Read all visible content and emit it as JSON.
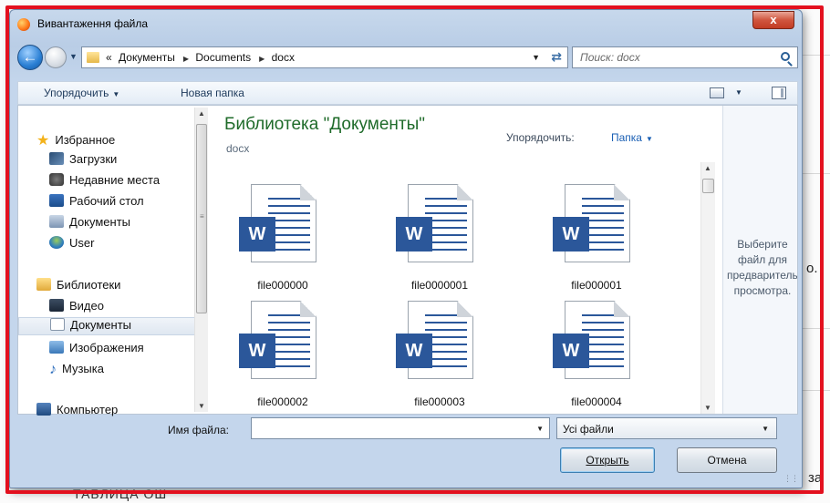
{
  "window": {
    "title": "Вивантаження файла",
    "close_label": "x"
  },
  "address": {
    "overflow_marker": "«",
    "crumbs": [
      "Документы",
      "Documents",
      "docx"
    ]
  },
  "search": {
    "placeholder": "Поиск: docx"
  },
  "toolbar": {
    "organize_label": "Упорядочить",
    "new_folder_label": "Новая папка"
  },
  "nav": {
    "favorites": "Избранное",
    "downloads": "Загрузки",
    "recent": "Недавние места",
    "desktop": "Рабочий стол",
    "documents": "Документы",
    "user": "User",
    "libraries": "Библиотеки",
    "video": "Видео",
    "lib_documents": "Документы",
    "images": "Изображения",
    "music": "Музыка",
    "computer": "Компьютер"
  },
  "content": {
    "library_title": "Библиотека \"Документы\"",
    "library_subtitle": "docx",
    "arrange_label": "Упорядочить:",
    "arrange_value": "Папка",
    "files": [
      "file000000",
      "file0000001",
      "file000001",
      "file000002",
      "file000003",
      "file000004"
    ],
    "file_badge": "W"
  },
  "preview": {
    "text": "Выберите файл для предварительного просмотра."
  },
  "bottom": {
    "filename_label": "Имя файла:",
    "filename_value": "",
    "filetype_value": "Усі файли",
    "open_label": "Открыть",
    "cancel_label": "Отмена"
  },
  "background": {
    "side_text": "о.",
    "corner_text": "за",
    "bottom_text": "ТАБЛИЦА ОШ"
  },
  "colors": {
    "highlight_frame": "#e3101e",
    "library_title": "#1f6b2a",
    "word_blue": "#2b579a"
  }
}
